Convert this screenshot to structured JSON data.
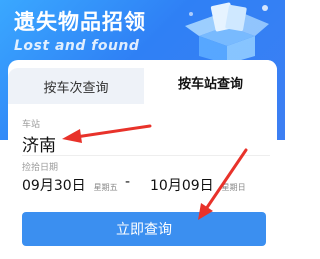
{
  "header": {
    "title": "遗失物品招领",
    "subtitle": "Lost and found"
  },
  "tabs": [
    {
      "label": "按车次查询",
      "active": false
    },
    {
      "label": "按车站查询",
      "active": true
    }
  ],
  "form": {
    "station_label": "车站",
    "station_value": "济南",
    "date_label": "捡拾日期",
    "start_date": "09月30日",
    "start_weekday": "星期五",
    "separator": "-",
    "end_date": "10月09日",
    "end_weekday": "星期日"
  },
  "actions": {
    "query_label": "立即查询"
  },
  "colors": {
    "banner": "#2f80f5",
    "button": "#3b8ff0",
    "annotation_arrow": "#e8322a"
  }
}
